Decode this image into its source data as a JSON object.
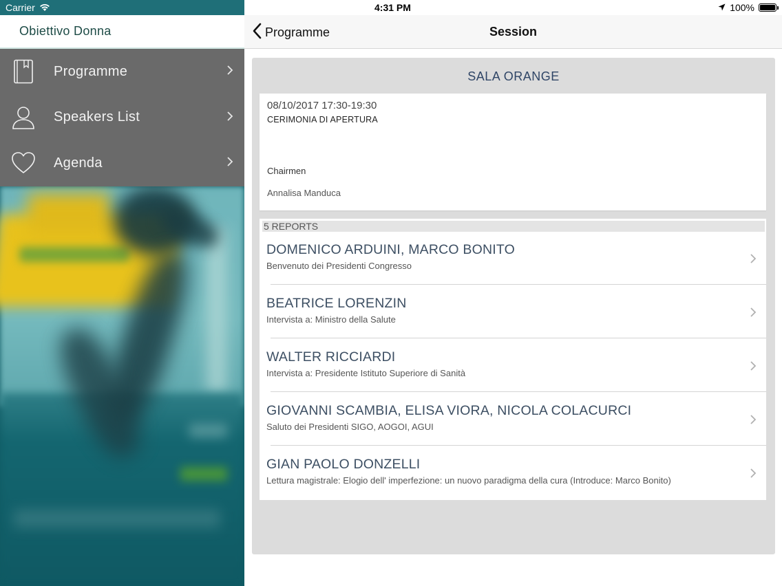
{
  "status_bar": {
    "carrier": "Carrier",
    "time": "4:31 PM",
    "battery": "100%"
  },
  "sidebar": {
    "title": "Obiettivo Donna",
    "items": [
      {
        "label": "Programme",
        "icon": "book-icon"
      },
      {
        "label": "Speakers List",
        "icon": "person-icon"
      },
      {
        "label": "Agenda",
        "icon": "heart-icon"
      }
    ]
  },
  "navbar": {
    "back_label": "Programme",
    "title": "Session"
  },
  "session": {
    "room": "SALA ORANGE",
    "datetime": "08/10/2017 17:30-19:30",
    "title": "CERIMONIA DI APERTURA",
    "chairmen_heading": "Chairmen",
    "chairmen": "Annalisa Manduca"
  },
  "reports": {
    "header": "5 REPORTS",
    "items": [
      {
        "name": "DOMENICO ARDUINI, MARCO BONITO",
        "subtitle": "Benvenuto dei Presidenti Congresso"
      },
      {
        "name": "BEATRICE LORENZIN",
        "subtitle": "Intervista a: Ministro della Salute"
      },
      {
        "name": "WALTER RICCIARDI",
        "subtitle": "Intervista a: Presidente Istituto Superiore di Sanità"
      },
      {
        "name": "GIOVANNI SCAMBIA, ELISA VIORA, NICOLA COLACURCI",
        "subtitle": "Saluto dei Presidenti SIGO, AOGOI, AGUI"
      },
      {
        "name": "GIAN PAOLO DONZELLI",
        "subtitle": "Lettura magistrale: Elogio dell' imperfezione: un nuovo paradigma della cura (Introduce: Marco Bonito)"
      }
    ]
  },
  "colors": {
    "status_left_bg": "#1f6f78",
    "menu_bg": "#6a6a6a",
    "content_bg": "#dcdcdc",
    "room_title": "#2f4566"
  }
}
